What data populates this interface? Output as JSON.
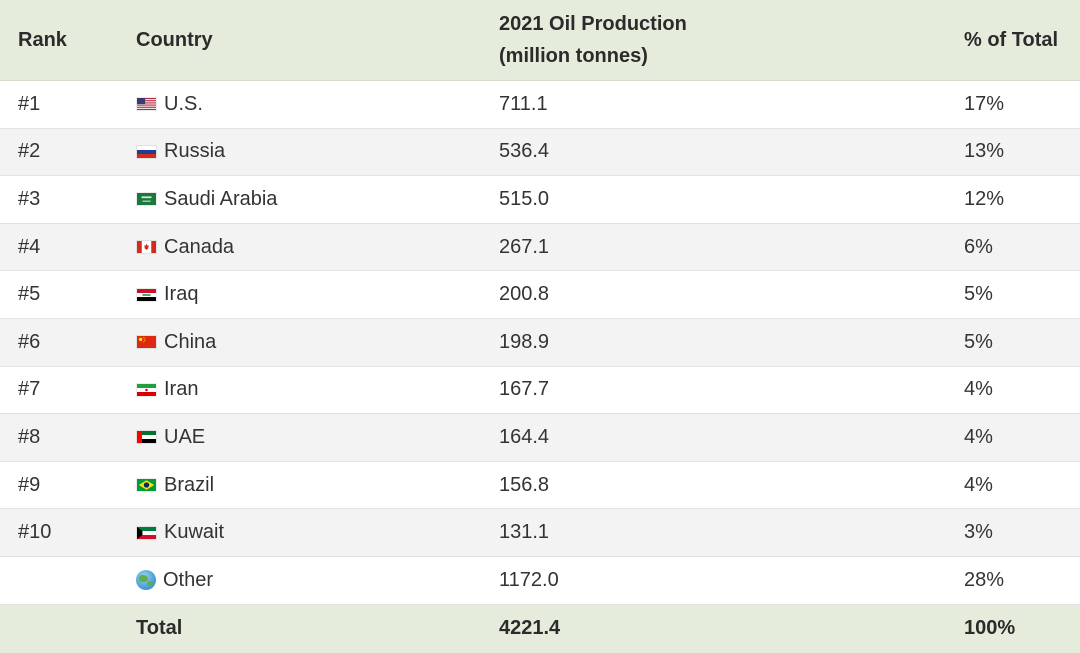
{
  "header": {
    "rank": "Rank",
    "country": "Country",
    "production_line1": "2021 Oil Production",
    "production_line2": "(million tonnes)",
    "percent": "% of Total"
  },
  "rows": [
    {
      "rank": "#1",
      "flag": "us-flag-icon",
      "country": "U.S.",
      "production": "711.1",
      "percent": "17%"
    },
    {
      "rank": "#2",
      "flag": "russia-flag-icon",
      "country": "Russia",
      "production": "536.4",
      "percent": "13%"
    },
    {
      "rank": "#3",
      "flag": "saudi-arabia-flag-icon",
      "country": "Saudi Arabia",
      "production": "515.0",
      "percent": "12%"
    },
    {
      "rank": "#4",
      "flag": "canada-flag-icon",
      "country": "Canada",
      "production": "267.1",
      "percent": "6%"
    },
    {
      "rank": "#5",
      "flag": "iraq-flag-icon",
      "country": "Iraq",
      "production": "200.8",
      "percent": "5%"
    },
    {
      "rank": "#6",
      "flag": "china-flag-icon",
      "country": "China",
      "production": "198.9",
      "percent": "5%"
    },
    {
      "rank": "#7",
      "flag": "iran-flag-icon",
      "country": "Iran",
      "production": "167.7",
      "percent": "4%"
    },
    {
      "rank": "#8",
      "flag": "uae-flag-icon",
      "country": "UAE",
      "production": "164.4",
      "percent": "4%"
    },
    {
      "rank": "#9",
      "flag": "brazil-flag-icon",
      "country": "Brazil",
      "production": "156.8",
      "percent": "4%"
    },
    {
      "rank": "#10",
      "flag": "kuwait-flag-icon",
      "country": "Kuwait",
      "production": "131.1",
      "percent": "3%"
    },
    {
      "rank": "",
      "flag": "globe-icon",
      "country": "Other",
      "production": "1172.0",
      "percent": "28%"
    }
  ],
  "footer": {
    "label": "Total",
    "production": "4221.4",
    "percent": "100%"
  },
  "colors": {
    "header_bg": "#e5ecdc",
    "stripe_bg": "#f3f3f3"
  }
}
